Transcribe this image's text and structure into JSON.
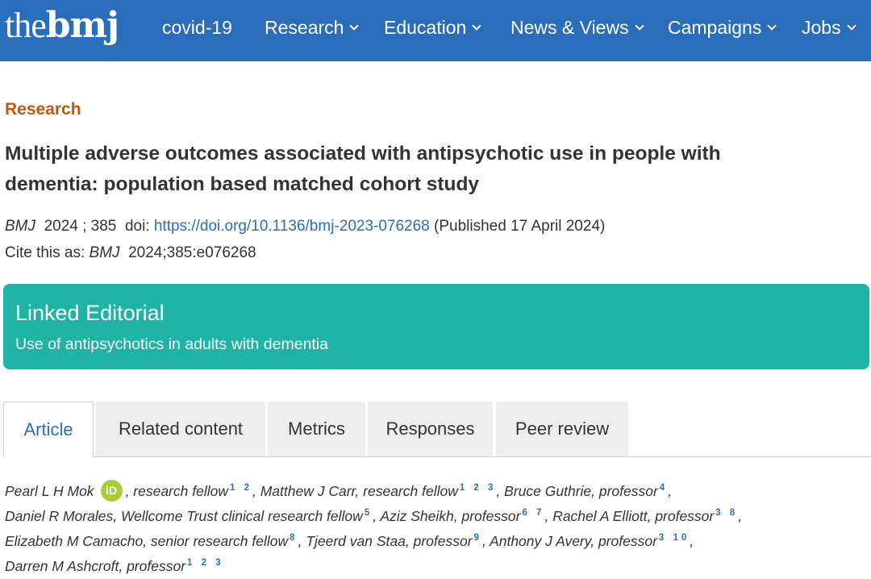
{
  "header": {
    "logo_the": "the",
    "logo_bmj": "bmj",
    "nav": [
      {
        "label": "covid-19",
        "dropdown": false
      },
      {
        "label": "Research",
        "dropdown": true
      },
      {
        "label": "Education",
        "dropdown": true
      },
      {
        "label": "News & Views",
        "dropdown": true
      },
      {
        "label": "Campaigns",
        "dropdown": true
      },
      {
        "label": "Jobs",
        "dropdown": true
      }
    ]
  },
  "article": {
    "section": "Research",
    "title": "Multiple adverse outcomes associated with antipsychotic use in people with dementia: population based matched cohort study",
    "journal": "BMJ",
    "year_vol": "2024 ; 385",
    "doi_label": "doi:",
    "doi_link": "https://doi.org/10.1136/bmj-2023-076268",
    "published": "(Published 17 April 2024)",
    "cite_label": "Cite this as:",
    "cite_journal": "BMJ",
    "cite_ref": "2024;385:e076268"
  },
  "editorial": {
    "heading": "Linked Editorial",
    "link": "Use of antipsychotics in adults with dementia"
  },
  "tabs": [
    "Article",
    "Related content",
    "Metrics",
    "Responses",
    "Peer review"
  ],
  "colors": {
    "header_bg": "#2a6ebb",
    "section": "#c2570d",
    "editorial_bg": "#1fb3a5",
    "link": "#2a6ebb",
    "orcid": "#a6ce39"
  },
  "authors": [
    {
      "name": "Pearl L H Mok",
      "orcid": true,
      "orcid_label": "iD",
      "role": ", research fellow",
      "affil": "1 2",
      "sep": ","
    },
    {
      "name": "Matthew J Carr",
      "role": ", research fellow",
      "affil": "1 2 3",
      "sep": ","
    },
    {
      "name": "Bruce Guthrie",
      "role": ", professor",
      "affil": "4",
      "sep": ","
    },
    {
      "name": "Daniel R Morales",
      "role": ", Wellcome Trust clinical research fellow",
      "affil": "5",
      "sep": ","
    },
    {
      "name": "Aziz Sheikh",
      "role": ", professor",
      "affil": "6 7",
      "sep": ","
    },
    {
      "name": "Rachel A Elliott",
      "role": ", professor",
      "affil": "3 8",
      "sep": ","
    },
    {
      "name": "Elizabeth M Camacho",
      "role": ", senior research fellow",
      "affil": "8",
      "sep": ","
    },
    {
      "name": "Tjeerd van Staa",
      "role": ", professor",
      "affil": "9",
      "sep": ","
    },
    {
      "name": "Anthony J Avery",
      "role": ", professor",
      "affil": "3 10",
      "sep": ","
    },
    {
      "name": "Darren M Ashcroft",
      "role": ", professor",
      "affil": "1 2 3",
      "sep": ""
    }
  ]
}
